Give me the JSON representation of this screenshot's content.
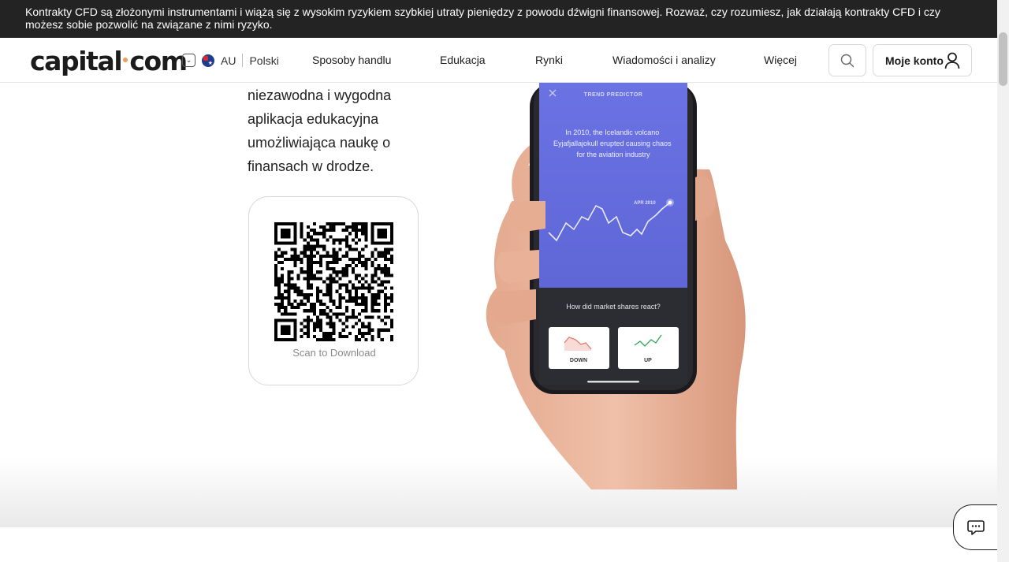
{
  "risk_banner": {
    "text": "Kontrakty CFD są złożonymi instrumentami i wiążą się z wysokim ryzykiem szybkiej utraty pieniędzy z powodu dźwigni finansowej. Rozważ, czy rozumiesz, jak działają kontrakty CFD i czy możesz sobie pozwolić na związane z nimi ryzyko."
  },
  "header": {
    "logo_left": "capital",
    "logo_right": "com",
    "region_code": "AU",
    "language": "Polski",
    "nav": [
      "Sposoby handlu",
      "Edukacja",
      "Rynki",
      "Wiadomości i analizy",
      "Więcej"
    ],
    "account_label": "Moje konto"
  },
  "main": {
    "description": "niezawodna i wygodna aplikacja edukacyjna umożliwiająca naukę o finansach w drodze.",
    "qr_caption": "Scan to Download"
  },
  "phone": {
    "app_title": "TREND PREDICTOR",
    "story": "In 2010, the Icelandic volcano Eyjafjallajokull erupted causing chaos for the aviation industry",
    "marker_label": "APR 2010",
    "question": "How did market shares react?",
    "down_label": "DOWN",
    "up_label": "UP"
  },
  "colors": {
    "banner_bg": "#232323",
    "phone_screen": "#6a6fe1",
    "logo_dot": "#f09c5a",
    "down_red": "#e05a4e",
    "up_green": "#2fa65a"
  },
  "icons": [
    "chevron-down-icon",
    "australia-flag-icon",
    "search-icon",
    "user-icon",
    "close-icon",
    "chat-icon"
  ]
}
